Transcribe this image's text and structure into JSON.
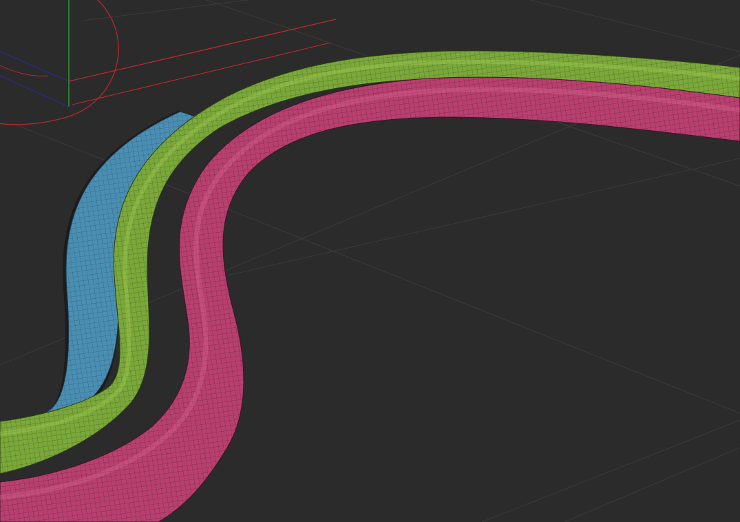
{
  "viewport": {
    "background_color": "#2b2b2b",
    "grid_color": "#3c3c3c"
  },
  "gizmo": {
    "x_axis_color": "#c0282c",
    "y_axis_color": "#2fa83a",
    "z_axis_color": "#2b2b9a",
    "rotation_ring_color": "#b42a2e"
  },
  "tubes": [
    {
      "name": "blue-tube",
      "color": "#4a8fb3",
      "wire_color": "#1c3a4a"
    },
    {
      "name": "green-tube",
      "color": "#7aa83a",
      "wire_color": "#2c3d14"
    },
    {
      "name": "pink-tube",
      "color": "#b8406f",
      "wire_color": "#3f1426"
    }
  ]
}
